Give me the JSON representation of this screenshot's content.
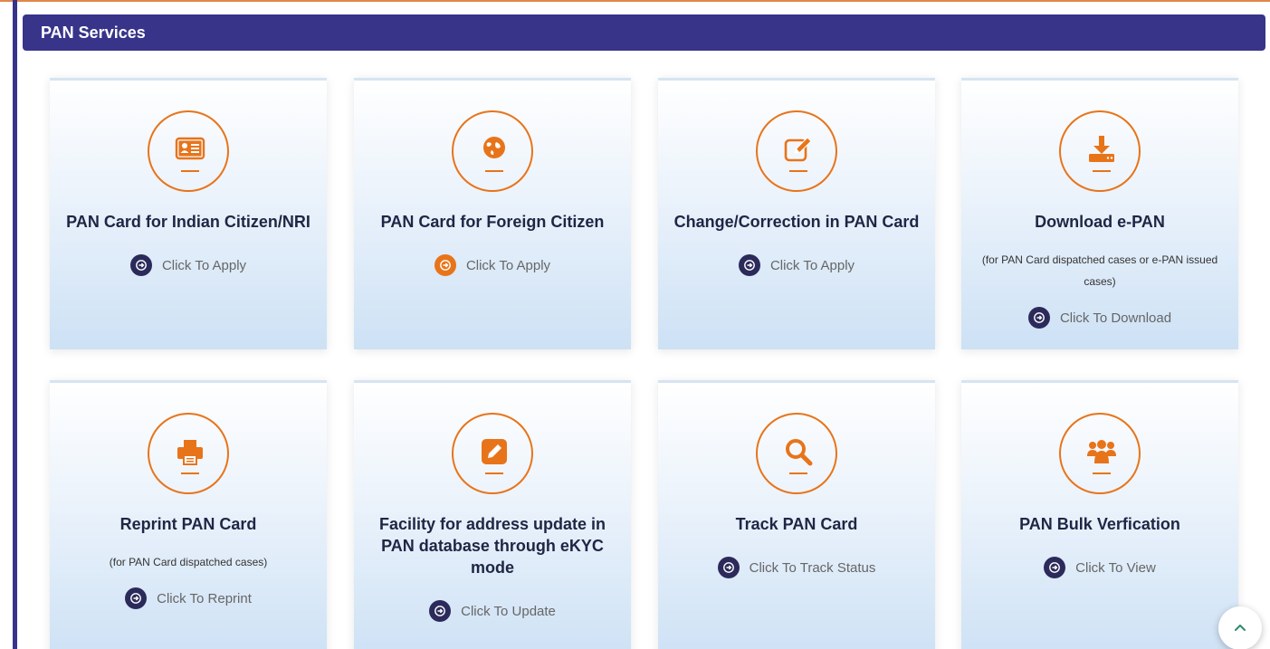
{
  "section": {
    "title": "PAN Services"
  },
  "colors": {
    "header_bg": "#37348a",
    "accent": "#e8741a",
    "bullet": "#2b2a5a"
  },
  "cards": [
    {
      "title": "PAN Card for Indian Citizen/NRI",
      "note": "",
      "action": "Click To Apply",
      "icon": "id-card-icon"
    },
    {
      "title": "PAN Card for Foreign Citizen",
      "note": "",
      "action": "Click To Apply",
      "icon": "globe-icon"
    },
    {
      "title": "Change/Correction in PAN Card",
      "note": "",
      "action": "Click To Apply",
      "icon": "edit-icon"
    },
    {
      "title": "Download e-PAN",
      "note": "(for PAN Card dispatched cases or e-PAN issued cases)",
      "action": "Click To Download",
      "icon": "download-icon"
    },
    {
      "title": "Reprint PAN Card",
      "note": "(for PAN Card dispatched cases)",
      "action": "Click To Reprint",
      "icon": "printer-icon"
    },
    {
      "title": "Facility for address update in PAN database through eKYC mode",
      "note": "",
      "action": "Click To Update",
      "icon": "pencil-icon"
    },
    {
      "title": "Track PAN Card",
      "note": "",
      "action": "Click To Track Status",
      "icon": "search-icon"
    },
    {
      "title": "PAN Bulk Verfication",
      "note": "",
      "action": "Click To View",
      "icon": "users-icon"
    }
  ],
  "scroll_top": {
    "icon": "chevron-up-icon"
  }
}
